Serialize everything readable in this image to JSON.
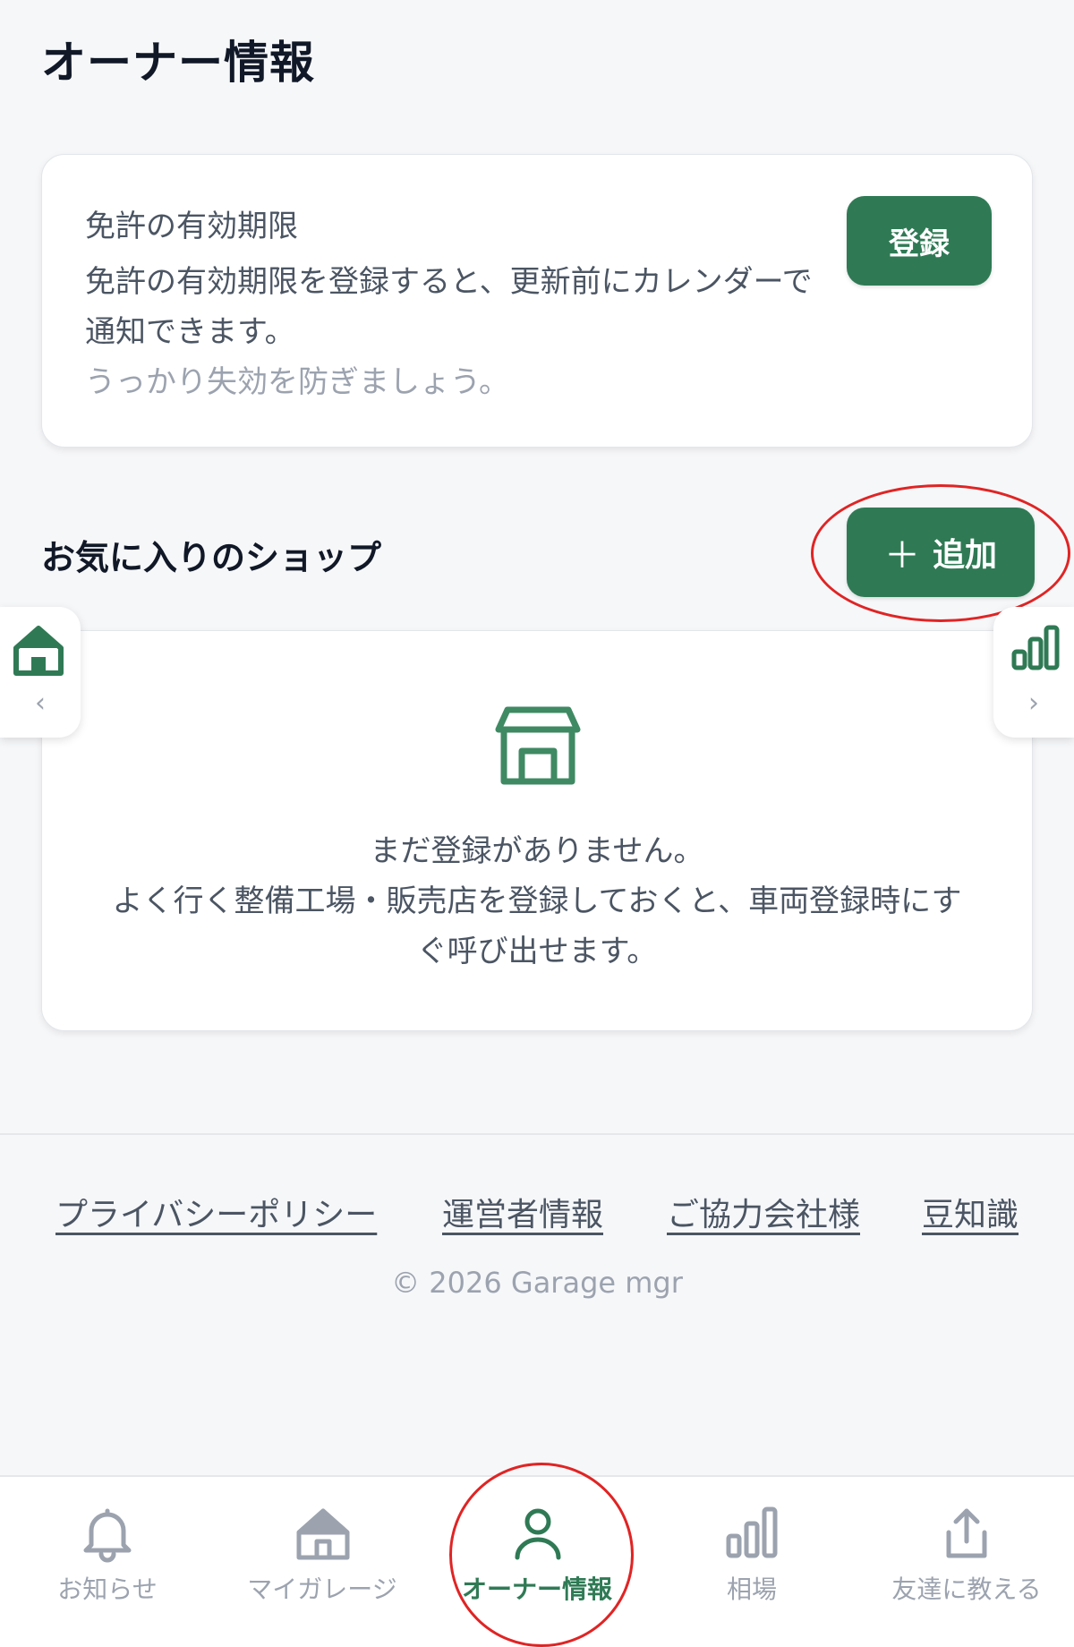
{
  "page": {
    "title": "オーナー情報"
  },
  "license": {
    "title": "免許の有効期限",
    "description": "免許の有効期限を登録すると、更新前にカレンダーで通知できます。",
    "hint": "うっかり失効を防ぎましょう。",
    "register_label": "登録"
  },
  "favorites": {
    "title": "お気に入りのショップ",
    "add_icon": "plus-icon",
    "add_label": "追加",
    "empty_title": "まだ登録がありません。",
    "empty_description": "よく行く整備工場・販売店を登録しておくと、車両登録時にすぐ呼び出せます。"
  },
  "side_tabs": {
    "left": {
      "icon": "house-icon",
      "chevron": "‹"
    },
    "right": {
      "icon": "bar-chart-icon",
      "chevron": "›"
    }
  },
  "footer": {
    "links": [
      "プライバシーポリシー",
      "運営者情報",
      "ご協力会社様",
      "豆知識"
    ],
    "copyright": "© 2026 Garage mgr"
  },
  "bottom_nav": {
    "items": [
      {
        "label": "お知らせ",
        "icon": "bell-icon",
        "active": false
      },
      {
        "label": "マイガレージ",
        "icon": "house-icon",
        "active": false
      },
      {
        "label": "オーナー情報",
        "icon": "person-icon",
        "active": true
      },
      {
        "label": "相場",
        "icon": "bar-chart-icon",
        "active": false
      },
      {
        "label": "友達に教える",
        "icon": "share-icon",
        "active": false
      }
    ]
  },
  "colors": {
    "accent": "#2f7a55",
    "annotation": "#e02424",
    "background": "#f6f7f9"
  }
}
